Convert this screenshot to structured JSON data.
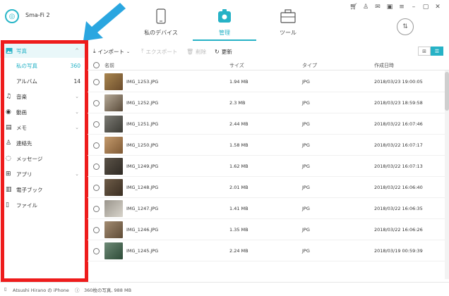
{
  "app": {
    "name": "Sma-Fi 2"
  },
  "tabs": [
    {
      "label": "私のデバイス"
    },
    {
      "label": "管理"
    },
    {
      "label": "ツール"
    }
  ],
  "sidebar": {
    "items": [
      {
        "label": "写真"
      },
      {
        "label": "私の写真",
        "count": "360"
      },
      {
        "label": "アルバム",
        "count": "14"
      },
      {
        "label": "音楽"
      },
      {
        "label": "動画"
      },
      {
        "label": "メモ"
      },
      {
        "label": "連絡先"
      },
      {
        "label": "メッセージ"
      },
      {
        "label": "アプリ"
      },
      {
        "label": "電子ブック"
      },
      {
        "label": "ファイル"
      }
    ]
  },
  "toolbar": {
    "import_label": "インポート",
    "export_label": "エクスポート",
    "delete_label": "削除",
    "refresh_label": "更新"
  },
  "table": {
    "columns": {
      "name": "名前",
      "size": "サイズ",
      "type": "タイプ",
      "date": "作成日時"
    },
    "rows": [
      {
        "name": "IMG_1253.JPG",
        "size": "1.94 MB",
        "type": "JPG",
        "date": "2018/03/23 19:00:05"
      },
      {
        "name": "IMG_1252.JPG",
        "size": "2.3 MB",
        "type": "JPG",
        "date": "2018/03/23 18:59:58"
      },
      {
        "name": "IMG_1251.JPG",
        "size": "2.44 MB",
        "type": "JPG",
        "date": "2018/03/22 16:07:46"
      },
      {
        "name": "IMG_1250.JPG",
        "size": "1.58 MB",
        "type": "JPG",
        "date": "2018/03/22 16:07:17"
      },
      {
        "name": "IMG_1249.JPG",
        "size": "1.62 MB",
        "type": "JPG",
        "date": "2018/03/22 16:07:13"
      },
      {
        "name": "IMG_1248.JPG",
        "size": "2.01 MB",
        "type": "JPG",
        "date": "2018/03/22 16:06:40"
      },
      {
        "name": "IMG_1247.JPG",
        "size": "1.41 MB",
        "type": "JPG",
        "date": "2018/03/22 16:06:35"
      },
      {
        "name": "IMG_1246.JPG",
        "size": "1.35 MB",
        "type": "JPG",
        "date": "2018/03/22 16:06:26"
      },
      {
        "name": "IMG_1245.JPG",
        "size": "2.24 MB",
        "type": "JPG",
        "date": "2018/03/19 00:59:39"
      }
    ]
  },
  "status": {
    "device": "Atsushi Hirano の iPhone",
    "summary": "360枚の写真, 988 MB"
  },
  "colors": {
    "accent": "#26b2c6",
    "annotation_arrow": "#2aa6e0",
    "annotation_box": "#ee1c1c"
  },
  "icons": {
    "window": [
      "cart-icon",
      "user-icon",
      "mail-icon",
      "gift-icon",
      "menu-icon",
      "minimize-icon",
      "maximize-icon",
      "close-icon"
    ]
  }
}
